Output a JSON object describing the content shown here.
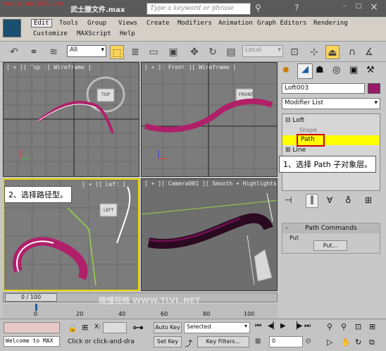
{
  "window": {
    "title": "武士腰文件.max",
    "watermark": "www.blue1000.com"
  },
  "search": {
    "placeholder": "Type a keyword or phrase"
  },
  "menu": [
    "Edit",
    "Tools",
    "Group",
    "Views",
    "Create",
    "Modifiers",
    "Animation",
    "Graph Editors",
    "Rendering",
    "Customize",
    "MAXScript",
    "Help"
  ],
  "toolbar": {
    "selection_filter": "All",
    "ref_coord": "Local"
  },
  "viewports": {
    "top": "[ + ][ Top ][ Wireframe ]",
    "front": "[ + ][ Front ][ Wireframe ]",
    "left": "[ + ][ Left ]",
    "camera": "[ + ][ Camera001 ][ Smooth + Highlights ]",
    "top_cube": "TOP",
    "front_cube": "FRONT",
    "left_cube": "LEFT"
  },
  "command_panel": {
    "object_name": "Loft003",
    "modifier_list": "Modifier List",
    "stack": [
      "Loft",
      "Shape",
      "Path",
      "Line"
    ],
    "rollout_title": "Path Commands",
    "group_label": "Put",
    "put_button": "Put..."
  },
  "callouts": {
    "one": "1、选择 Path 子对象层。",
    "two": "2、选择路径型。"
  },
  "timeline": {
    "frame": "0 / 100",
    "ticks": [
      "0",
      "20",
      "40",
      "60",
      "80",
      "100"
    ],
    "site_watermark": "瞧懂视频 WWW.TLVL.NET"
  },
  "status": {
    "welcome": "Welcome to MAX",
    "prompt": "Click or click-and-dra",
    "x_label": "X:",
    "auto_key": "Auto Key",
    "selected": "Selected",
    "set_key": "Set Key",
    "key_filters": "Key Filters...",
    "frame_value": "0"
  },
  "colors": {
    "highlight": "#ffff00",
    "callout_border": "#cc0000",
    "loft_curve": "#b0206a",
    "object_swatch": "#9a1a6a"
  }
}
